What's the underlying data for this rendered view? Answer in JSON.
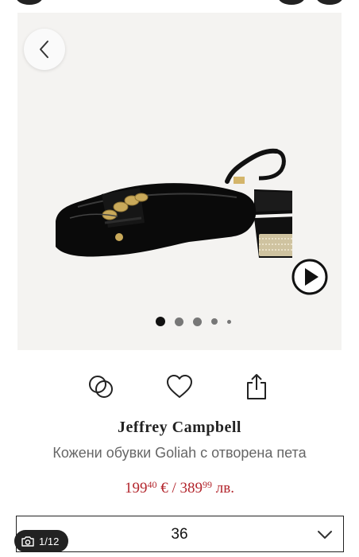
{
  "gallery": {
    "back_icon": "chevron-left-icon",
    "play_icon": "play-icon",
    "image_count": 5,
    "active_index": 0
  },
  "actions": {
    "compare_icon": "compare-icon",
    "favorite_icon": "heart-icon",
    "share_icon": "share-icon"
  },
  "product": {
    "brand": "Jeffrey Campbell",
    "name": "Кожени обувки Goliah с отворена пета",
    "price_eur_whole": "199",
    "price_eur_cents": "40",
    "price_eur_suffix": " € / ",
    "price_bgn_whole": "389",
    "price_bgn_cents": "99",
    "price_bgn_suffix": " лв."
  },
  "size_select": {
    "value": "36",
    "icon": "chevron-down-icon"
  },
  "photo_counter": {
    "icon": "camera-icon",
    "label": "1/12"
  },
  "colors": {
    "price": "#b3262d",
    "gallery_bg": "#f4f3f1"
  }
}
